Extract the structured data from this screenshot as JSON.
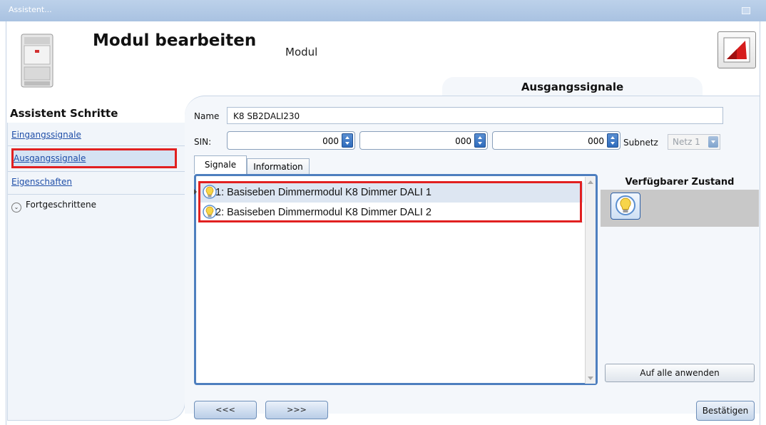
{
  "window": {
    "title": "Assistent..."
  },
  "header": {
    "title": "Modul bearbeiten",
    "subtitle": "Modul",
    "step_tab": "Ausgangssignale"
  },
  "sidebar": {
    "title": "Assistent Schritte",
    "items": [
      {
        "label": "Eingangssignale"
      },
      {
        "label": "Ausgangssignale",
        "active": true
      },
      {
        "label": "Eigenschaften"
      }
    ],
    "advanced_label": "Fortgeschrittene"
  },
  "form": {
    "name_label": "Name",
    "name_value": "K8 SB2DALI230",
    "sin_label": "SIN:",
    "sin_values": [
      "000",
      "000",
      "000"
    ],
    "subnet_label": "Subnetz",
    "subnet_value": "Netz 1"
  },
  "tabs": [
    {
      "label": "Signale",
      "active": true
    },
    {
      "label": "Information"
    }
  ],
  "signals": [
    {
      "label": "1: Basiseben Dimmermodul K8 Dimmer DALI 1",
      "selected": true
    },
    {
      "label": "2: Basiseben Dimmermodul K8 Dimmer DALI 2"
    }
  ],
  "state_panel": {
    "title": "Verfügbarer Zustand",
    "apply_label": "Auf alle anwenden"
  },
  "footer": {
    "prev_label": "<<<",
    "next_label": ">>>",
    "confirm_label": "Bestätigen"
  },
  "colors": {
    "highlight_red": "#e12020",
    "link_blue": "#1f4ea8",
    "accent_blue": "#4e7fbf"
  },
  "icons": [
    "bulb-icon",
    "module-device-icon",
    "app-logo-icon",
    "chevron-down-icon",
    "spinner-icon",
    "dropdown-arrow-icon"
  ]
}
